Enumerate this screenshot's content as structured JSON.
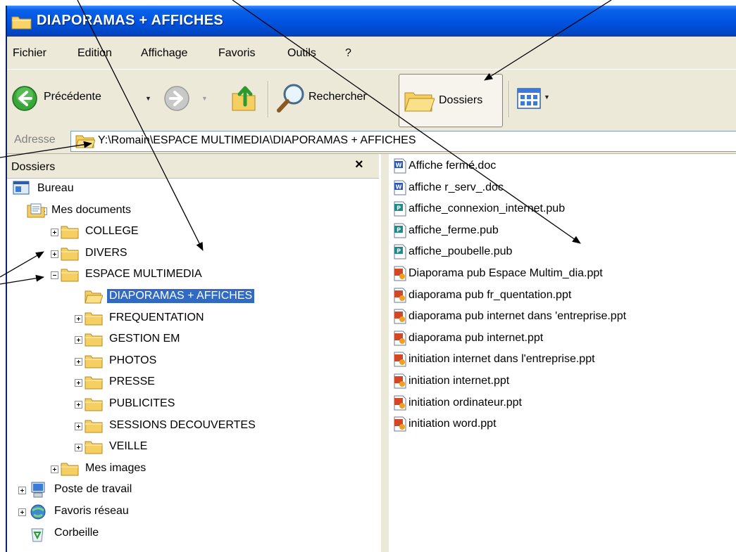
{
  "window": {
    "title": "DIAPORAMAS + AFFICHES"
  },
  "menu": [
    "Fichier",
    "Edition",
    "Affichage",
    "Favoris",
    "Outils",
    "?"
  ],
  "toolbar": {
    "back_label": "Précédente",
    "search_label": "Rechercher",
    "folders_label": "Dossiers"
  },
  "address": {
    "label": "Adresse",
    "value": "Y:\\Romain\\ESPACE MULTIMEDIA\\DIAPORAMAS + AFFICHES"
  },
  "folders_pane": {
    "title": "Dossiers",
    "close": "×",
    "tree": [
      {
        "label": "Bureau",
        "toggle": "",
        "icon": "desktop-icon"
      },
      {
        "label": "Mes documents",
        "toggle": "minus",
        "icon": "documents-icon"
      },
      {
        "label": "COLLEGE",
        "toggle": "plus",
        "icon": "folder-icon"
      },
      {
        "label": "DIVERS",
        "toggle": "plus",
        "icon": "folder-icon"
      },
      {
        "label": "ESPACE MULTIMEDIA",
        "toggle": "minus",
        "icon": "folder-icon"
      },
      {
        "label": "DIAPORAMAS + AFFICHES",
        "toggle": "",
        "icon": "open-folder-icon",
        "selected": true
      },
      {
        "label": "FREQUENTATION",
        "toggle": "plus",
        "icon": "folder-icon"
      },
      {
        "label": "GESTION EM",
        "toggle": "plus",
        "icon": "folder-icon"
      },
      {
        "label": "PHOTOS",
        "toggle": "plus",
        "icon": "folder-icon"
      },
      {
        "label": "PRESSE",
        "toggle": "plus",
        "icon": "folder-icon"
      },
      {
        "label": "PUBLICITES",
        "toggle": "plus",
        "icon": "folder-icon"
      },
      {
        "label": "SESSIONS DECOUVERTES",
        "toggle": "plus",
        "icon": "folder-icon"
      },
      {
        "label": "VEILLE",
        "toggle": "plus",
        "icon": "folder-icon"
      },
      {
        "label": "Mes images",
        "toggle": "plus",
        "icon": "folder-icon"
      },
      {
        "label": "Poste de travail",
        "toggle": "plus",
        "icon": "computer-icon"
      },
      {
        "label": "Favoris réseau",
        "toggle": "plus",
        "icon": "network-icon"
      },
      {
        "label": "Corbeille",
        "toggle": "",
        "icon": "recycle-bin-icon"
      }
    ]
  },
  "files": [
    {
      "name": "Affiche fermé.doc",
      "type": "word-doc-icon"
    },
    {
      "name": "affiche r_serv_.doc",
      "type": "word-doc-icon"
    },
    {
      "name": "affiche_connexion_internet.pub",
      "type": "publisher-icon"
    },
    {
      "name": "affiche_ferme.pub",
      "type": "publisher-icon"
    },
    {
      "name": "affiche_poubelle.pub",
      "type": "publisher-icon"
    },
    {
      "name": "Diaporama pub Espace Multim_dia.ppt",
      "type": "powerpoint-icon"
    },
    {
      "name": "diaporama pub fr_quentation.ppt",
      "type": "powerpoint-icon"
    },
    {
      "name": "diaporama pub internet dans 'entreprise.ppt",
      "type": "powerpoint-icon"
    },
    {
      "name": "diaporama pub internet.ppt",
      "type": "powerpoint-icon"
    },
    {
      "name": "initiation internet dans l'entreprise.ppt",
      "type": "powerpoint-icon"
    },
    {
      "name": "initiation internet.ppt",
      "type": "powerpoint-icon"
    },
    {
      "name": "initiation ordinateur.ppt",
      "type": "powerpoint-icon"
    },
    {
      "name": "initiation word.ppt",
      "type": "powerpoint-icon"
    }
  ],
  "colors": {
    "titlebar": "#0054e3",
    "selection": "#316ac5",
    "chrome": "#ece9d8",
    "folder": "#f5cf62"
  }
}
